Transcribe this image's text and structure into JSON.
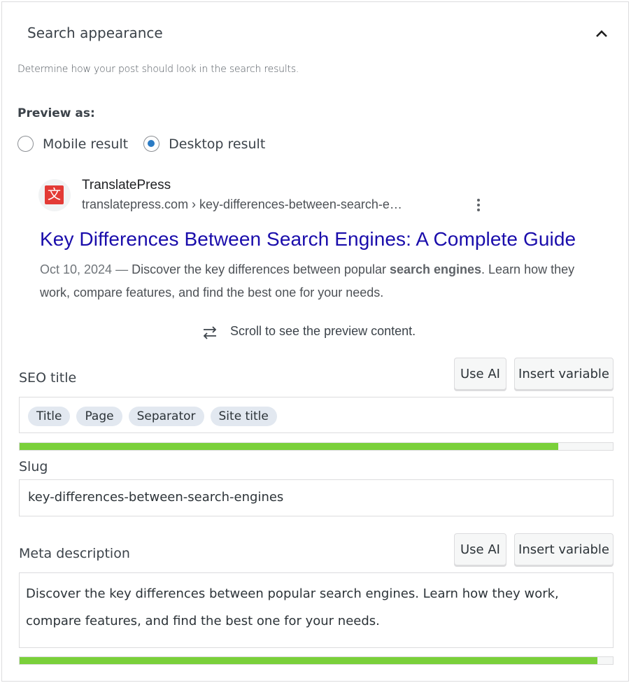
{
  "panel": {
    "title": "Search appearance",
    "description": "Determine how your post should look in the search results."
  },
  "preview": {
    "label": "Preview as:",
    "options": [
      {
        "label": "Mobile result",
        "checked": false
      },
      {
        "label": "Desktop result",
        "checked": true
      }
    ]
  },
  "serp": {
    "favicon_glyph": "文",
    "site_name": "TranslatePress",
    "url": "translatepress.com › key-differences-between-search-e…",
    "title": "Key Differences Between Search Engines: A Complete Guide",
    "date": "Oct 10, 2024 —",
    "desc_pre": " Discover the key differences between popular ",
    "desc_bold": "search engines",
    "desc_post": ". Learn how they",
    "desc_line2": "work, compare features, and find the best one for your needs."
  },
  "scroll_hint": "Scroll to see the preview content.",
  "seo_title": {
    "label": "Seo title",
    "label_display": "SEO title",
    "use_ai": "Use AI",
    "insert_variable": "Insert variable",
    "chips": [
      "Title",
      "Page",
      "Separator",
      "Site title"
    ],
    "progress": 0.908
  },
  "slug": {
    "label": "Slug",
    "value": "key-differences-between-search-engines"
  },
  "meta": {
    "label": "Meta description",
    "use_ai": "Use AI",
    "insert_variable": "Insert variable",
    "value": "Discover the key differences between popular search engines. Learn how they work, compare features, and find the best one for your needs.",
    "progress": 0.974
  },
  "colors": {
    "accent": "#2b7bc4",
    "link": "#1a0dab",
    "progress_good": "#7ad03a",
    "favicon": "#e33b36"
  }
}
